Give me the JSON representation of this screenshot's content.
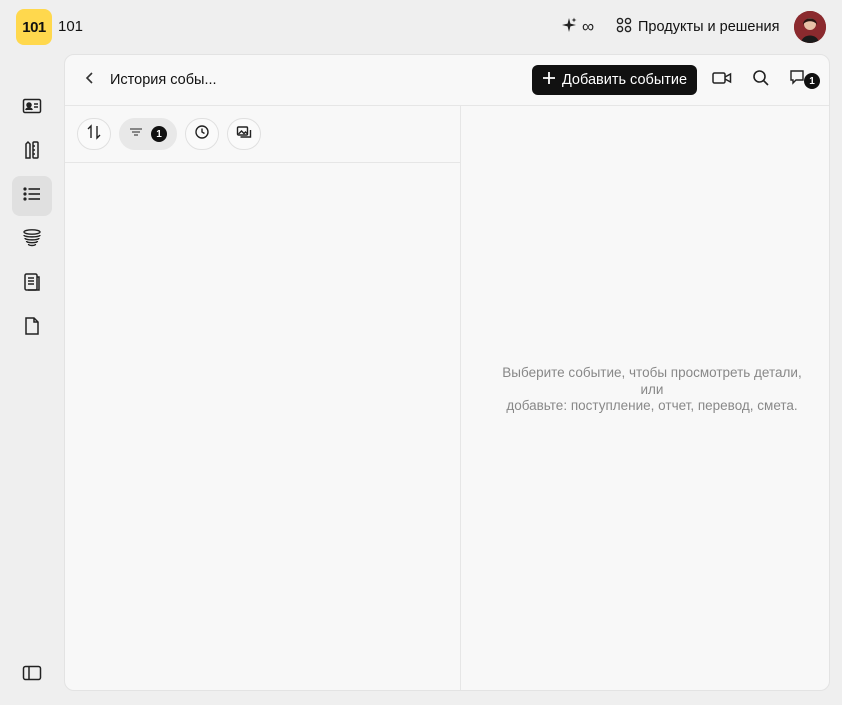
{
  "app": {
    "logo_text": "101",
    "name": "101"
  },
  "topbar": {
    "ai_label": "∞",
    "products_label": "Продукты и решения"
  },
  "rail": {
    "items": [
      {
        "icon": "contact-card-icon"
      },
      {
        "icon": "ruler-pencil-icon"
      },
      {
        "icon": "list-icon",
        "active": true
      },
      {
        "icon": "coins-stack-icon"
      },
      {
        "icon": "notebook-icon"
      },
      {
        "icon": "document-icon"
      }
    ]
  },
  "panel": {
    "title": "История собы...",
    "add_event_label": "Добавить событие",
    "messages_badge": "1"
  },
  "toolbar": {
    "filter_badge": "1"
  },
  "empty_state": {
    "line1": "Выберите событие, чтобы просмотреть детали,",
    "line2": "или",
    "line3": "добавьте: поступление, отчет, перевод, смета."
  }
}
